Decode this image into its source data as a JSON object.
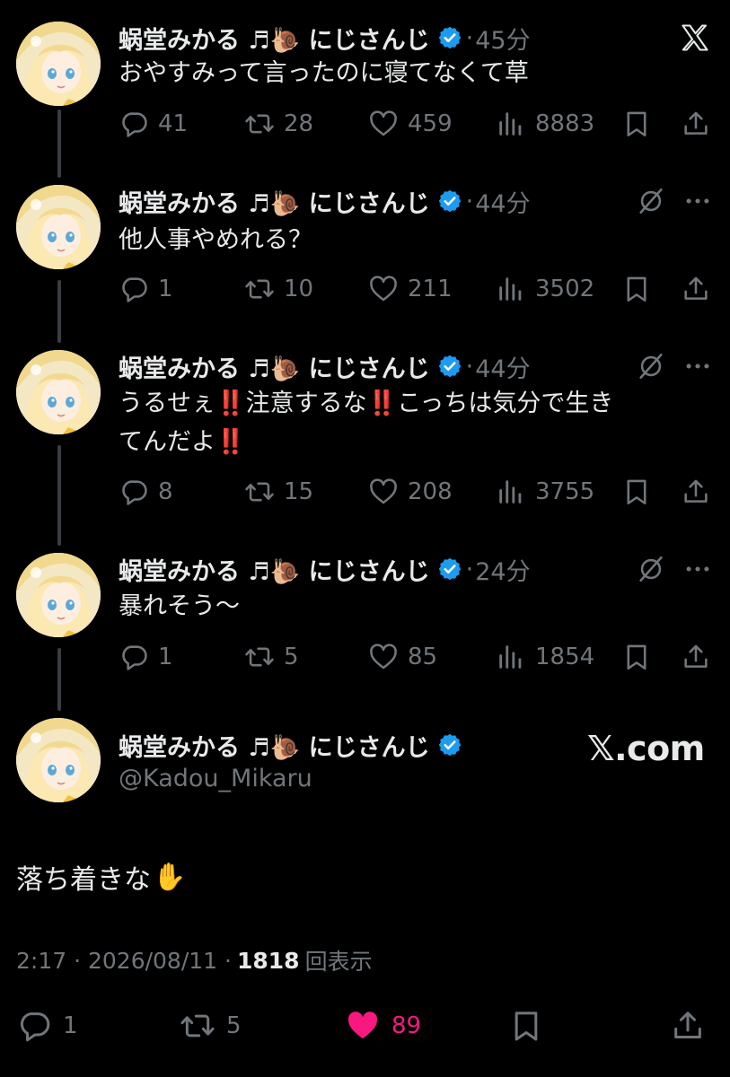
{
  "author": {
    "name": "蜗堂みかる ♬🐌 にじさんじ",
    "handle": "@Kadou_Mikaru",
    "verified": true
  },
  "thread": [
    {
      "time": "45分",
      "text": "おやすみって言ったのに寝てなくて草",
      "replies": "41",
      "retweets": "28",
      "likes": "459",
      "views": "8883",
      "corner_icon": "x-logo-icon"
    },
    {
      "time": "44分",
      "text": "他人事やめれる？",
      "replies": "1",
      "retweets": "10",
      "likes": "211",
      "views": "3502",
      "corner_icon": "grok-icon"
    },
    {
      "time": "44分",
      "text_line1": "うるせぇ‼️注意するな‼️こっちは気分で生き",
      "text_line2": "てんだよ‼️",
      "replies": "8",
      "retweets": "15",
      "likes": "208",
      "views": "3755",
      "corner_icon": "grok-icon"
    },
    {
      "time": "24分",
      "text": "暴れそう〜",
      "replies": "1",
      "retweets": "5",
      "likes": "85",
      "views": "1854",
      "corner_icon": "grok-icon"
    }
  ],
  "main_tweet": {
    "text": "落ち着きな",
    "emoji": "✋",
    "watermark": "𝕏.com",
    "meta_time": "2:17 · 2026/08/11 ·",
    "meta_views": "1818",
    "meta_views_label": "回表示",
    "replies": "1",
    "retweets": "5",
    "likes": "89",
    "liked": true
  },
  "colors": {
    "background": "#000000",
    "text": "#e7e9ea",
    "muted": "#71767b",
    "verified": "#1d9bf0",
    "like_active": "#f91880",
    "thread_line": "#3a3d41"
  }
}
